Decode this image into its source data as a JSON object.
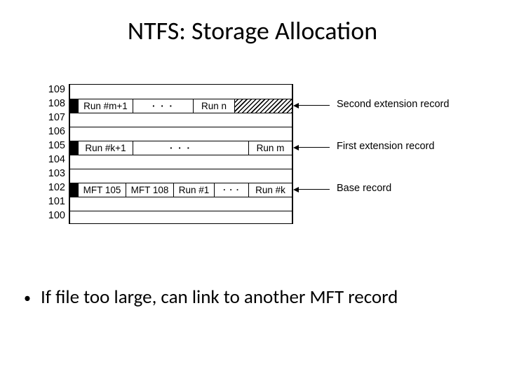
{
  "title": "NTFS: Storage Allocation",
  "bullet1": "If file too large, can link to another MFT record",
  "rows": {
    "r109": "109",
    "r108": "108",
    "r107": "107",
    "r106": "106",
    "r105": "105",
    "r104": "104",
    "r103": "103",
    "r102": "102",
    "r101": "101",
    "r100": "100"
  },
  "rec108": {
    "run_a": "Run #m+1",
    "dots": "· · ·",
    "run_b": "Run n"
  },
  "rec105": {
    "run_a": "Run #k+1",
    "dots": "· · ·",
    "run_b": "Run m"
  },
  "rec102": {
    "mft1": "MFT 105",
    "mft2": "MFT 108",
    "run1": "Run #1",
    "dots": "· · ·",
    "runk": "Run #k"
  },
  "labels": {
    "l1": "Second extension record",
    "l2": "First extension record",
    "l3": "Base record"
  }
}
